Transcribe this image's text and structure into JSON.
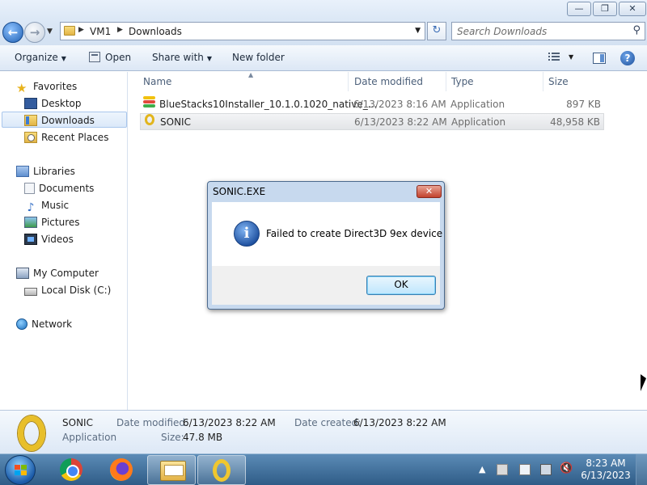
{
  "window": {
    "controls": {
      "minimize": "—",
      "maximize": "❐",
      "close": "✕"
    }
  },
  "address_bar": {
    "crumbs": [
      "VM1",
      "Downloads"
    ],
    "search_placeholder": "Search Downloads",
    "refresh_glyph": "↻"
  },
  "toolbar": {
    "organize": "Organize",
    "open": "Open",
    "share_with": "Share with",
    "new_folder": "New folder",
    "help": "?"
  },
  "nav": {
    "favorites": "Favorites",
    "desktop": "Desktop",
    "downloads": "Downloads",
    "recent_places": "Recent Places",
    "libraries": "Libraries",
    "documents": "Documents",
    "music": "Music",
    "pictures": "Pictures",
    "videos": "Videos",
    "my_computer": "My Computer",
    "local_disk": "Local Disk (C:)",
    "network": "Network"
  },
  "columns": {
    "name": "Name",
    "date_modified": "Date modified",
    "type": "Type",
    "size": "Size"
  },
  "files": [
    {
      "name": "BlueStacks10Installer_10.1.0.1020_native_...",
      "date": "6/13/2023 8:16 AM",
      "type": "Application",
      "size": "897 KB",
      "icon": "bluestacks-icon"
    },
    {
      "name": "SONIC",
      "date": "6/13/2023 8:22 AM",
      "type": "Application",
      "size": "48,958 KB",
      "icon": "sonic-ring-icon",
      "selected": true
    }
  ],
  "details": {
    "name": "SONIC",
    "kind": "Application",
    "modified_label": "Date modified:",
    "modified_value": "6/13/2023 8:22 AM",
    "created_label": "Date created:",
    "created_value": "6/13/2023 8:22 AM",
    "size_label": "Size:",
    "size_value": "47.8 MB"
  },
  "dialog": {
    "title": "SONIC.EXE",
    "message": "Failed to create Direct3D 9ex device",
    "ok": "OK",
    "close": "✕",
    "info": "i"
  },
  "taskbar": {
    "clock_time": "8:23 AM",
    "clock_date": "6/13/2023",
    "tray_arrow": "▲"
  },
  "colors": {
    "accent": "#1f5fb3",
    "taskbar": "#2f5c87",
    "dialog_frame": "#c7d9ee",
    "selection": "#dbe9f9"
  }
}
